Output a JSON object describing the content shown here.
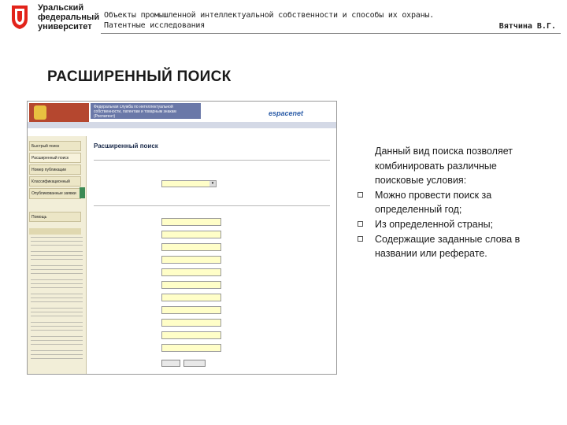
{
  "logo": {
    "university": [
      "Уральский",
      "федеральный",
      "университет"
    ],
    "icon": "urfu-shield-icon"
  },
  "header": {
    "course_line1": "Объекты промышленной интеллектуальной собственности и способы их охраны.",
    "course_line2": "Патентные исследования",
    "author": "Вятчина В.Г."
  },
  "slide_title": "РАСШИРЕННЫЙ ПОИСК",
  "screenshot": {
    "org_name": "Федеральная служба по интеллектуальной собственности, патентам и товарным знакам (Роспатент)",
    "brand": "espacenet",
    "search_heading": "Расширенный поиск",
    "sidebar_items": [
      "Быстрый поиск",
      "Расширенный поиск",
      "Номер публикации",
      "Классификационный поиск",
      "Опубликованные заявки",
      "Помощь"
    ]
  },
  "bullets": {
    "intro": [
      "Данный вид поиска позволяет",
      "комбинировать различные",
      "поисковые условия:"
    ],
    "items": [
      [
        "Можно провести поиск за",
        "определенный год;"
      ],
      [
        "Из определенной страны;"
      ],
      [
        "Содержащие заданные слова в",
        "названии или реферате."
      ]
    ],
    "marker_icon": "hollow-square-bullet-icon"
  }
}
